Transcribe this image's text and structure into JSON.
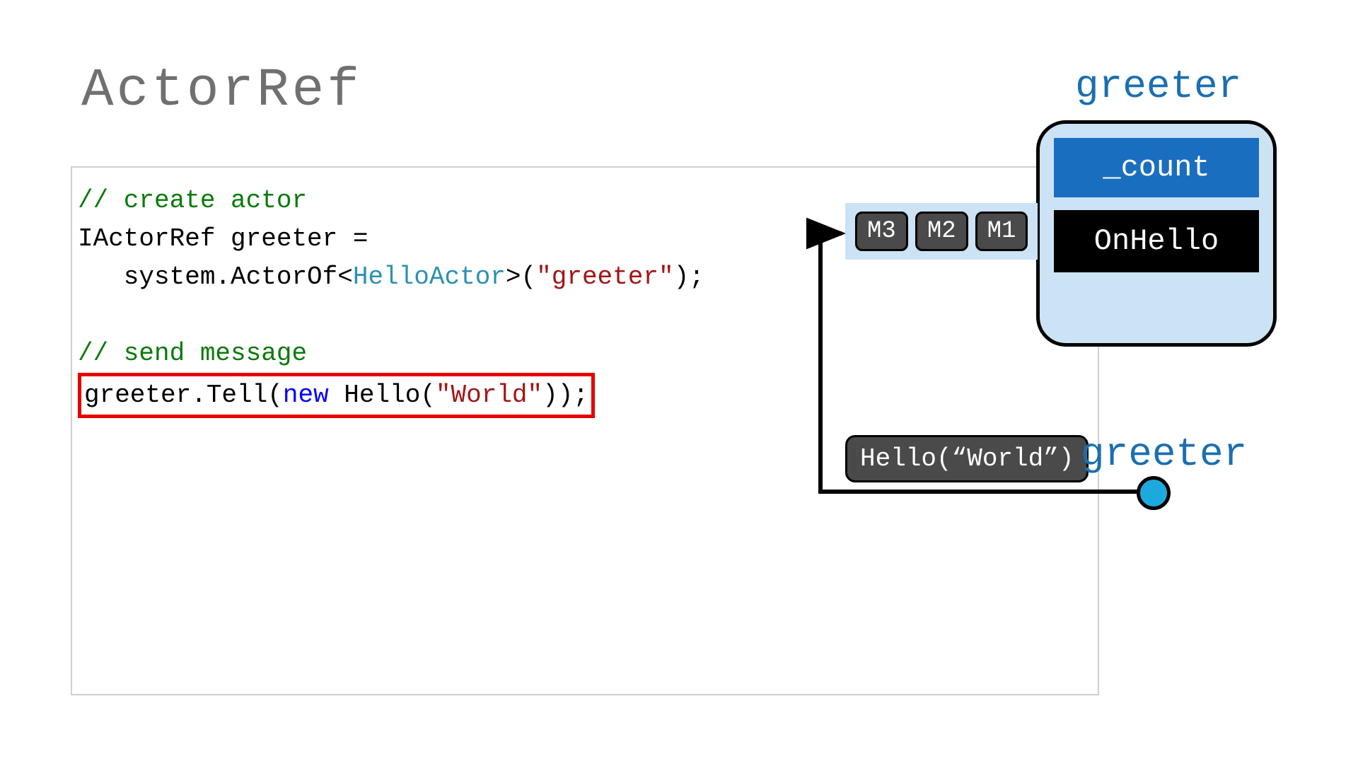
{
  "slide": {
    "title": "ActorRef"
  },
  "code": {
    "comment1": "// create actor",
    "line2_a": "IActorRef greeter =",
    "line3_indent": "   system.ActorOf<",
    "line3_type": "HelloActor",
    "line3_mid": ">(",
    "line3_str": "\"greeter\"",
    "line3_end": ");",
    "comment2": "// send message",
    "line5_a": "greeter.Tell(",
    "line5_kw": "new",
    "line5_b": " Hello(",
    "line5_str": "\"World\"",
    "line5_end": "));"
  },
  "diagram": {
    "greeter_top_label": "greeter",
    "actor_state": "_count",
    "actor_handler": "OnHello",
    "mailbox": {
      "m3": "M3",
      "m2": "M2",
      "m1": "M1"
    },
    "message_pill": "Hello(“World”)",
    "greeter_bottom_label": "greeter"
  }
}
